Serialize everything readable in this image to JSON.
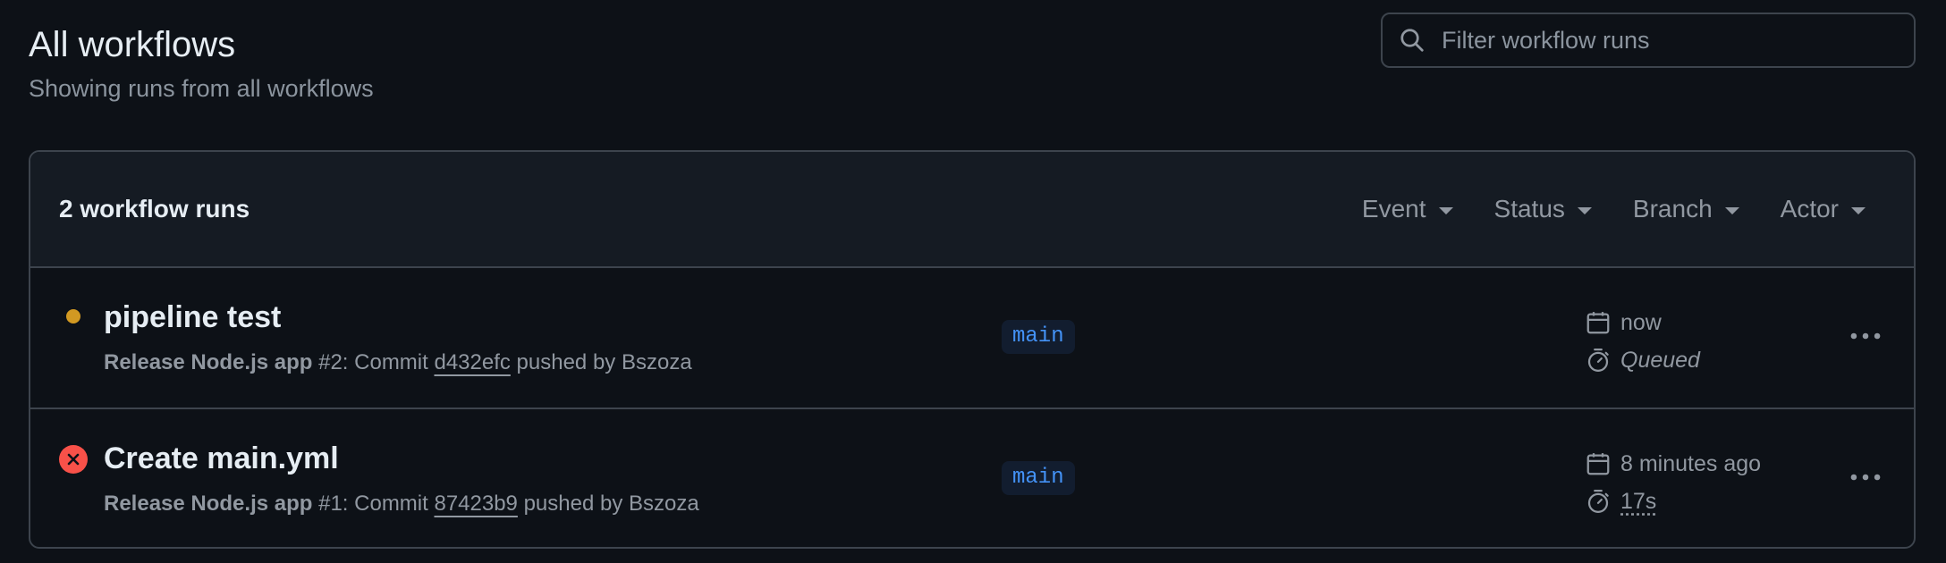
{
  "header": {
    "title": "All workflows",
    "subtitle": "Showing runs from all workflows"
  },
  "search": {
    "placeholder": "Filter workflow runs"
  },
  "panel": {
    "runs_count": "2 workflow runs",
    "filters": [
      "Event",
      "Status",
      "Branch",
      "Actor"
    ]
  },
  "runs": [
    {
      "status": "queued",
      "status_color": "#d29922",
      "title": "pipeline test",
      "workflow": "Release Node.js app",
      "meta_middle": " #2: Commit ",
      "sha": "d432efc",
      "meta_end": " pushed by Bszoza",
      "branch": "main",
      "time": "now",
      "duration": "Queued"
    },
    {
      "status": "failure",
      "status_color": "#f85149",
      "title": "Create main.yml",
      "workflow": "Release Node.js app",
      "meta_middle": " #1: Commit ",
      "sha": "87423b9",
      "meta_end": " pushed by Bszoza",
      "branch": "main",
      "time": "8 minutes ago",
      "duration": "17s"
    }
  ]
}
